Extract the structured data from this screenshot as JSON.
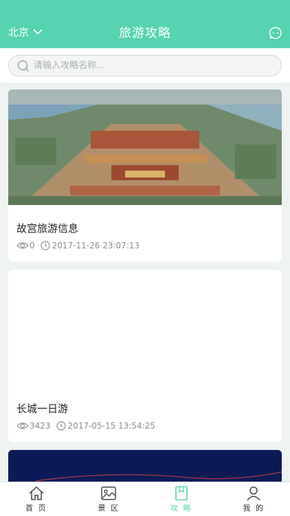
{
  "header": {
    "city": "北京",
    "title": "旅游攻略"
  },
  "search": {
    "placeholder": "请输入攻略名称..."
  },
  "cards": [
    {
      "title": "故宫旅游信息",
      "views": "0",
      "time": "2017-11-26 23:07:13"
    },
    {
      "title": "长城一日游",
      "views": "3423",
      "time": "2017-05-15 13:54:25"
    }
  ],
  "tabs": [
    {
      "label": "首 页"
    },
    {
      "label": "景 区"
    },
    {
      "label": "攻 略"
    },
    {
      "label": "我 的"
    }
  ],
  "colors": {
    "accent": "#56d3b1"
  },
  "icons": [
    "chevron-down-icon",
    "message-icon",
    "search-icon",
    "eye-icon",
    "clock-icon",
    "home-icon",
    "image-icon",
    "book-icon",
    "user-icon"
  ]
}
